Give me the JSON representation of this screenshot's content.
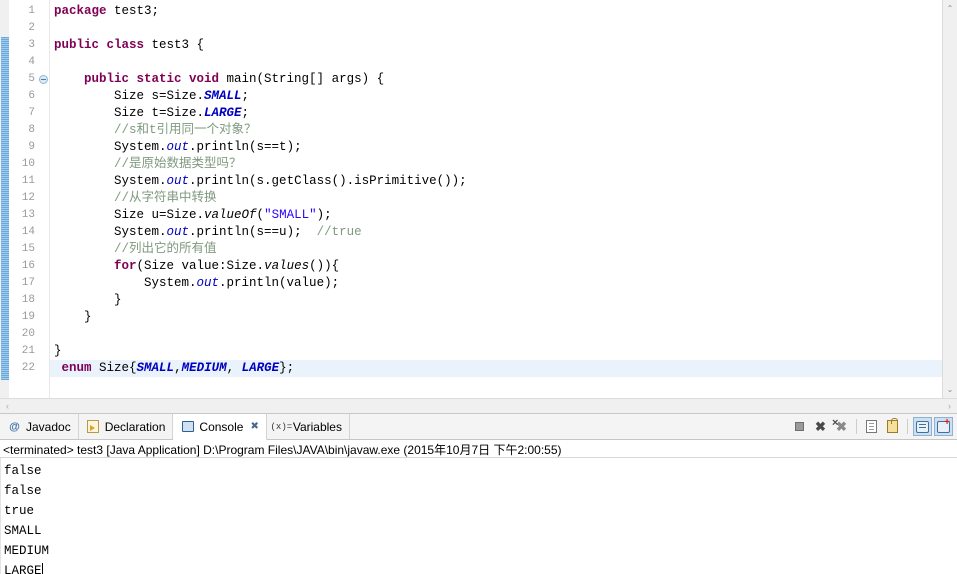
{
  "editor": {
    "lines": [
      {
        "n": "1",
        "tokens": [
          {
            "t": "package ",
            "c": "kw"
          },
          {
            "t": "test3;",
            "c": "plain"
          }
        ]
      },
      {
        "n": "2",
        "tokens": []
      },
      {
        "n": "3",
        "tokens": [
          {
            "t": "public class ",
            "c": "kw"
          },
          {
            "t": "test3 {",
            "c": "plain"
          }
        ]
      },
      {
        "n": "4",
        "tokens": []
      },
      {
        "n": "5",
        "fold": true,
        "tokens": [
          {
            "t": "    ",
            "c": "plain"
          },
          {
            "t": "public static void ",
            "c": "kw"
          },
          {
            "t": "main(String[] args) {",
            "c": "plain"
          }
        ]
      },
      {
        "n": "6",
        "tokens": [
          {
            "t": "        Size s=Size.",
            "c": "plain"
          },
          {
            "t": "SMALL",
            "c": "sfld"
          },
          {
            "t": ";",
            "c": "plain"
          }
        ]
      },
      {
        "n": "7",
        "tokens": [
          {
            "t": "        Size t=Size.",
            "c": "plain"
          },
          {
            "t": "LARGE",
            "c": "sfld"
          },
          {
            "t": ";",
            "c": "plain"
          }
        ]
      },
      {
        "n": "8",
        "tokens": [
          {
            "t": "        //s和t引用同一个对象？",
            "c": "cmt"
          }
        ]
      },
      {
        "n": "9",
        "tokens": [
          {
            "t": "        System.",
            "c": "plain"
          },
          {
            "t": "out",
            "c": "fld"
          },
          {
            "t": ".println(s==t);",
            "c": "plain"
          }
        ]
      },
      {
        "n": "10",
        "tokens": [
          {
            "t": "        //是原始数据类型吗？",
            "c": "cmt"
          }
        ]
      },
      {
        "n": "11",
        "tokens": [
          {
            "t": "        System.",
            "c": "plain"
          },
          {
            "t": "out",
            "c": "fld"
          },
          {
            "t": ".println(s.getClass().isPrimitive());",
            "c": "plain"
          }
        ]
      },
      {
        "n": "12",
        "tokens": [
          {
            "t": "        //从字符串中转换",
            "c": "cmt"
          }
        ]
      },
      {
        "n": "13",
        "tokens": [
          {
            "t": "        Size u=Size.",
            "c": "plain"
          },
          {
            "t": "valueOf",
            "c": "smth"
          },
          {
            "t": "(",
            "c": "plain"
          },
          {
            "t": "\"SMALL\"",
            "c": "str"
          },
          {
            "t": ");",
            "c": "plain"
          }
        ]
      },
      {
        "n": "14",
        "tokens": [
          {
            "t": "        System.",
            "c": "plain"
          },
          {
            "t": "out",
            "c": "fld"
          },
          {
            "t": ".println(s==u);  ",
            "c": "plain"
          },
          {
            "t": "//true",
            "c": "cmt"
          }
        ]
      },
      {
        "n": "15",
        "tokens": [
          {
            "t": "        //列出它的所有值",
            "c": "cmt"
          }
        ]
      },
      {
        "n": "16",
        "tokens": [
          {
            "t": "        ",
            "c": "plain"
          },
          {
            "t": "for",
            "c": "kw"
          },
          {
            "t": "(Size value:Size.",
            "c": "plain"
          },
          {
            "t": "values",
            "c": "smth"
          },
          {
            "t": "()){",
            "c": "plain"
          }
        ]
      },
      {
        "n": "17",
        "tokens": [
          {
            "t": "            System.",
            "c": "plain"
          },
          {
            "t": "out",
            "c": "fld"
          },
          {
            "t": ".println(value);",
            "c": "plain"
          }
        ]
      },
      {
        "n": "18",
        "tokens": [
          {
            "t": "        }",
            "c": "plain"
          }
        ]
      },
      {
        "n": "19",
        "tokens": [
          {
            "t": "    }",
            "c": "plain"
          }
        ]
      },
      {
        "n": "20",
        "tokens": []
      },
      {
        "n": "21",
        "tokens": [
          {
            "t": "}",
            "c": "plain"
          }
        ]
      },
      {
        "n": "22",
        "highlight": true,
        "tokens": [
          {
            "t": " ",
            "c": "plain"
          },
          {
            "t": "enum",
            "c": "kw"
          },
          {
            "t": " Size{",
            "c": "plain"
          },
          {
            "t": "SMALL",
            "c": "sfld"
          },
          {
            "t": ",",
            "c": "plain"
          },
          {
            "t": "MEDIUM",
            "c": "sfld"
          },
          {
            "t": ", ",
            "c": "plain"
          },
          {
            "t": "LARGE",
            "c": "sfld"
          },
          {
            "t": "};",
            "c": "plain"
          }
        ]
      }
    ],
    "scroll": {
      "up_arrow": "⌃",
      "down_arrow": "⌄",
      "left_arrow": "‹",
      "right_arrow": "›"
    }
  },
  "bottom_panel": {
    "tabs": [
      {
        "label": "Javadoc",
        "icon": "at-icon",
        "active": false,
        "closable": false
      },
      {
        "label": "Declaration",
        "icon": "declaration-icon",
        "active": false,
        "closable": false
      },
      {
        "label": "Console",
        "icon": "console-icon",
        "active": true,
        "closable": true,
        "close_glyph": "✖"
      },
      {
        "label": "Variables",
        "icon": "variables-icon",
        "active": false,
        "closable": false,
        "icon_text": "(x)="
      }
    ],
    "toolbar": [
      {
        "name": "terminate-button",
        "glyph": "stop-icon"
      },
      {
        "name": "remove-launch-button",
        "glyph": "remove-icon"
      },
      {
        "name": "remove-all-launches-button",
        "glyph": "remove-all-icon"
      },
      {
        "name": "clear-console-button",
        "glyph": "clear-console-icon"
      },
      {
        "name": "scroll-lock-button",
        "glyph": "scroll-lock-icon"
      },
      {
        "name": "pin-console-button",
        "glyph": "pin-console-icon",
        "toggled": true
      },
      {
        "name": "open-console-button",
        "glyph": "new-console-icon",
        "toggled": true
      }
    ],
    "console": {
      "header": "<terminated> test3 [Java Application] D:\\Program Files\\JAVA\\bin\\javaw.exe (2015年10月7日 下午2:00:55)",
      "output": [
        "false",
        "false",
        "true",
        "SMALL",
        "MEDIUM",
        "LARGE"
      ]
    }
  },
  "colors": {
    "keyword": "#7f0055",
    "comment": "#7f9a7f",
    "string": "#2a00ff",
    "field": "#0000c0",
    "current_line": "#eaf2fb",
    "change_bar": "#7fb8e2",
    "toggled_button": "#cde0f2"
  }
}
